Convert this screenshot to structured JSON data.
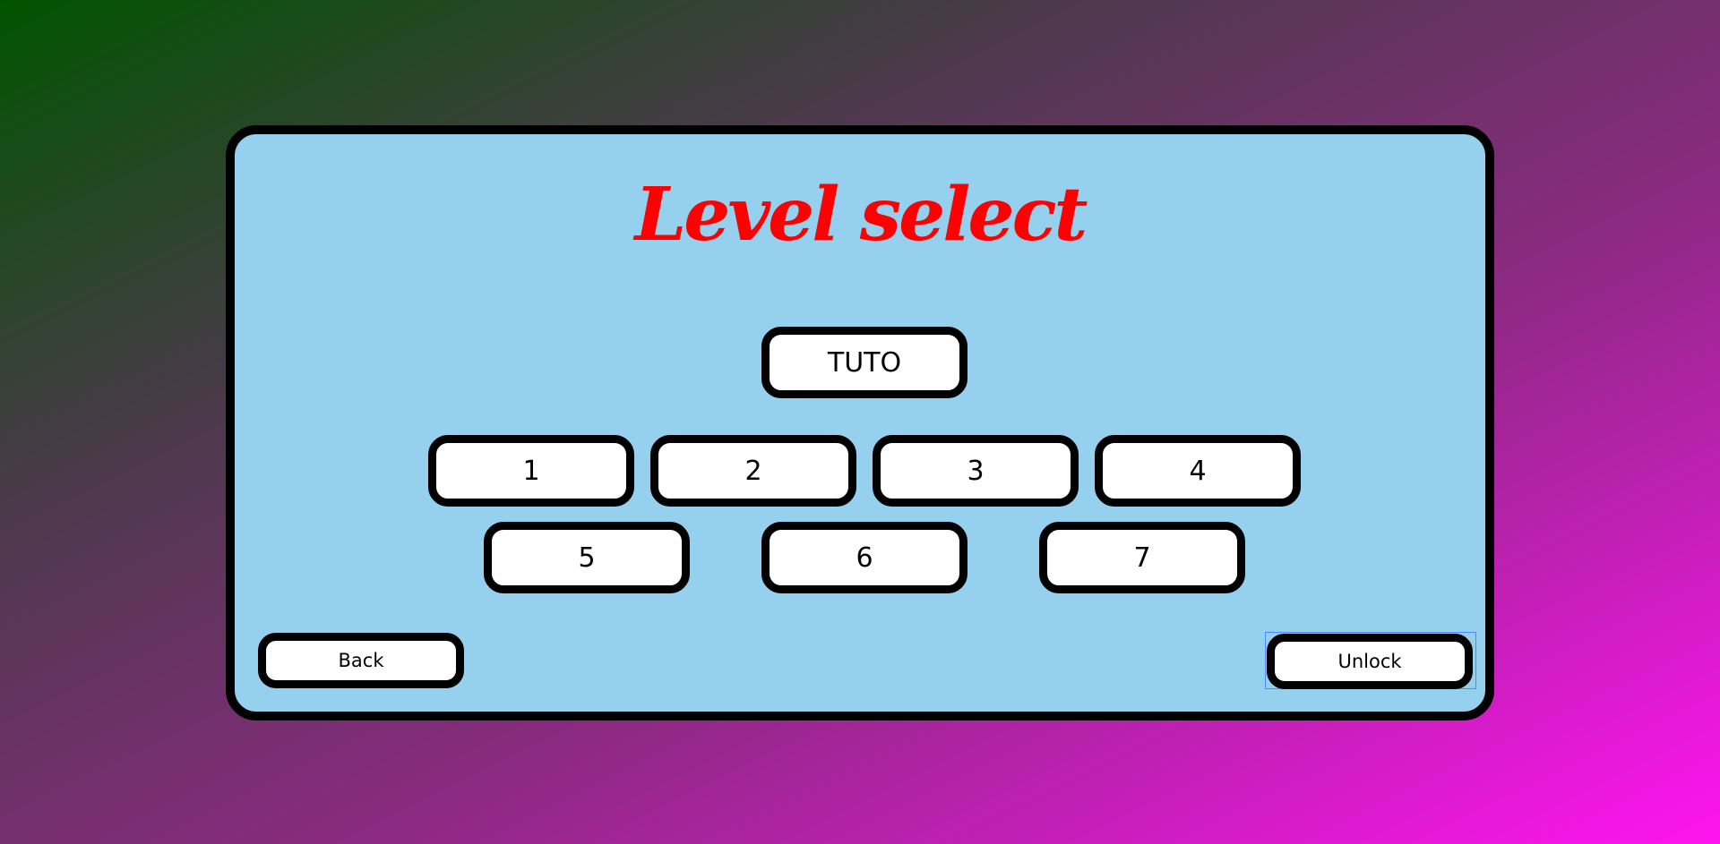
{
  "title": "Level select",
  "levels": {
    "tutorial": "TUTO",
    "row1": [
      "1",
      "2",
      "3",
      "4"
    ],
    "row2": [
      "5",
      "6",
      "7"
    ]
  },
  "buttons": {
    "back": "Back",
    "unlock": "Unlock"
  },
  "colors": {
    "panel_bg": "#95d1ee",
    "title": "#ff0000",
    "button_bg": "#ffffff",
    "border": "#000000",
    "gradient_start": "#005400",
    "gradient_end": "#ff14f0"
  }
}
